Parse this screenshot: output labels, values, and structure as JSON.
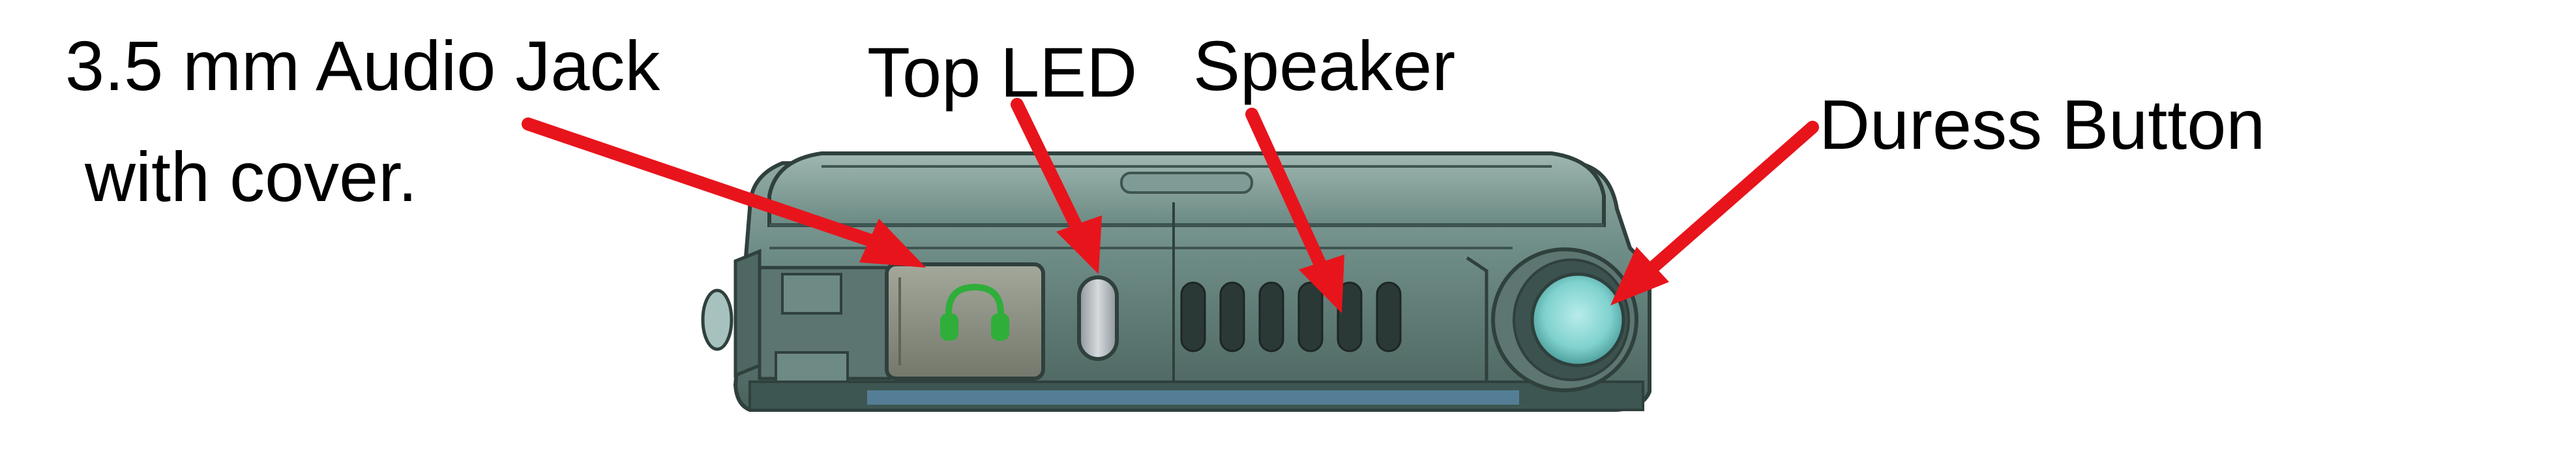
{
  "labels": {
    "audio_jack_line1": "3.5 mm Audio Jack",
    "audio_jack_line2": "with cover.",
    "top_led": "Top LED",
    "speaker": "Speaker",
    "duress_button": "Duress Button"
  },
  "colors": {
    "arrow": "#e8141c",
    "body": "#5f7b76",
    "body_dark": "#2f403d",
    "body_light": "#8fa8a2",
    "cover": "#8b8f82",
    "headphone_icon": "#2fae3a",
    "led": "#b9bfc4",
    "duress": "#7fd2cf"
  }
}
